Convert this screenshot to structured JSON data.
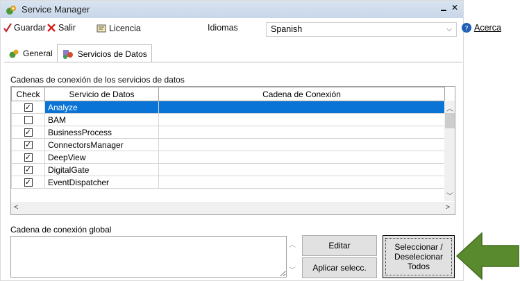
{
  "window": {
    "title": "Service Manager"
  },
  "toolbar": {
    "save_label": "Guardar",
    "exit_label": "Salir",
    "license_label": "Licencia",
    "languages_label": "Idiomas",
    "language_selected": "Spanish",
    "about_label": "Acerca"
  },
  "tabs": [
    {
      "label": "General"
    },
    {
      "label": "Servicios de Datos"
    }
  ],
  "services": {
    "group_label": "Cadenas de conexión de los servicios de datos",
    "columns": {
      "check": "Check",
      "service": "Servicio de Datos",
      "connection": "Cadena de Conexión"
    },
    "rows": [
      {
        "name": "Analyze",
        "checked": true,
        "selected": true,
        "connection": ""
      },
      {
        "name": "BAM",
        "checked": false,
        "selected": false,
        "connection": ""
      },
      {
        "name": "BusinessProcess",
        "checked": true,
        "selected": false,
        "connection": ""
      },
      {
        "name": "ConnectorsManager",
        "checked": true,
        "selected": false,
        "connection": ""
      },
      {
        "name": "DeepView",
        "checked": true,
        "selected": false,
        "connection": ""
      },
      {
        "name": "DigitalGate",
        "checked": true,
        "selected": false,
        "connection": ""
      },
      {
        "name": "EventDispatcher",
        "checked": true,
        "selected": false,
        "connection": ""
      }
    ]
  },
  "global": {
    "label": "Cadena de conexión global",
    "value": ""
  },
  "buttons": {
    "edit": "Editar",
    "apply": "Aplicar selecc.",
    "toggle_line1": "Seleccionar /",
    "toggle_line2": "Deselecionar",
    "toggle_line3": "Todos"
  },
  "colors": {
    "selection": "#0a74d6",
    "arrow": "#5a8a2e",
    "titlebar": "#d3dff0"
  }
}
